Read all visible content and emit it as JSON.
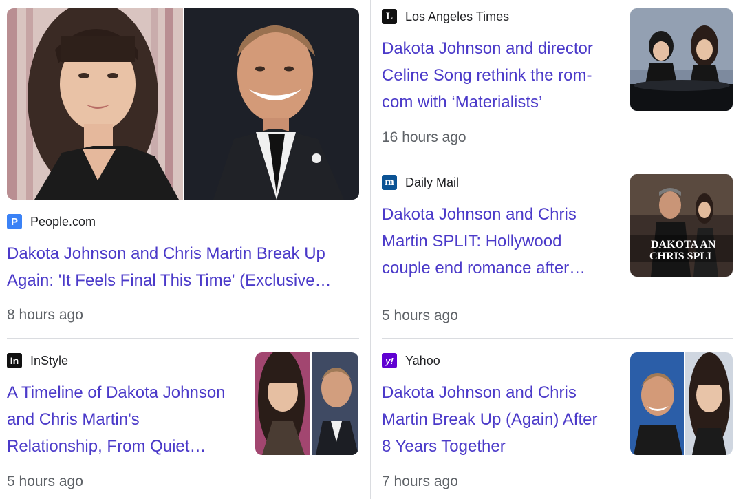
{
  "stories": [
    {
      "source": "People.com",
      "favicon_letter": "P",
      "favicon_color": "#3b82f6",
      "headline_line1": "Dakota Johnson and Chris Martin Break Up",
      "headline_line2": "Again: 'It Feels Final This Time' (Exclusive…",
      "time": "8 hours ago"
    },
    {
      "source": "InStyle",
      "favicon_letter": "In",
      "favicon_color": "#111111",
      "headline_line1": "A Timeline of Dakota Johnson",
      "headline_line2": "and Chris Martin's",
      "headline_line3": "Relationship, From Quiet…",
      "time": "5 hours ago"
    },
    {
      "source": "Los Angeles Times",
      "favicon_letter": "L",
      "favicon_color": "#111111",
      "headline_line1": "Dakota Johnson and director",
      "headline_line2": "Celine Song rethink the rom-",
      "headline_line3": "com with ‘Materialists’",
      "time": "16 hours ago"
    },
    {
      "source": "Daily Mail",
      "favicon_letter": "m",
      "favicon_color": "#0b5394",
      "headline_line1": "Dakota Johnson and Chris",
      "headline_line2": "Martin SPLIT: Hollywood",
      "headline_line3": "couple end romance after…",
      "time": "5 hours ago",
      "thumb_text_1": "DAKOTA AN",
      "thumb_text_2": "CHRIS SPLI"
    },
    {
      "source": "Yahoo",
      "favicon_letter": "y!",
      "favicon_color": "#6001d2",
      "headline_line1": "Dakota Johnson and Chris",
      "headline_line2": "Martin Break Up (Again) After",
      "headline_line3": "8 Years Together",
      "time": "7 hours ago"
    }
  ]
}
